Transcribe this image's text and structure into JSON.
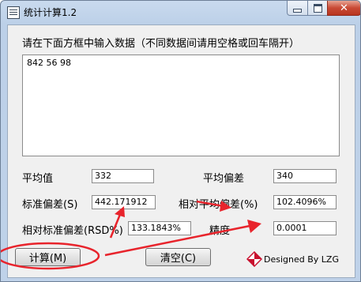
{
  "window": {
    "title": "统计计算1.2",
    "close_glyph": "✕"
  },
  "prompt": "请在下面方框中输入数据（不同数据间请用空格或回车隔开）",
  "input_data": "842 56 98",
  "fields": {
    "mean_label": "平均值",
    "mean_value": "332",
    "avg_dev_label": "平均偏差",
    "avg_dev_value": "340",
    "std_dev_label": "标准偏差(S)",
    "std_dev_value": "442.171912",
    "rel_avg_dev_label": "相对平均偏差(%)",
    "rel_avg_dev_value": "102.4096%",
    "rel_std_dev_label": "相对标准偏差(RSD%)",
    "rel_std_dev_value": "133.1843%",
    "precision_label": "精度",
    "precision_value": "0.0001"
  },
  "buttons": {
    "calculate": "计算(M)",
    "clear": "清空(C)"
  },
  "credit": "Designed By LZG",
  "annotation_color": "#e8242c"
}
